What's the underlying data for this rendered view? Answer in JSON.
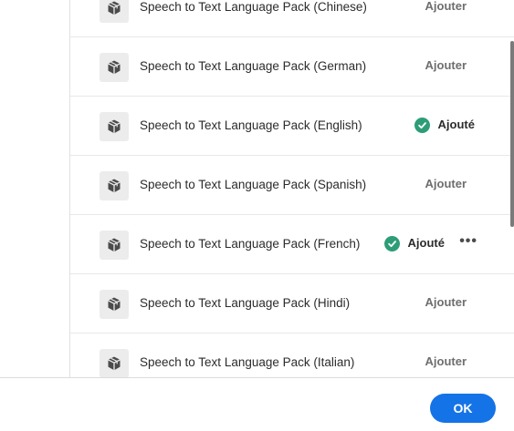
{
  "packages": [
    {
      "label": "Speech to Text Language Pack (Chinese)",
      "status": "add"
    },
    {
      "label": "Speech to Text Language Pack (German)",
      "status": "add"
    },
    {
      "label": "Speech to Text Language Pack (English)",
      "status": "added"
    },
    {
      "label": "Speech to Text Language Pack (Spanish)",
      "status": "add"
    },
    {
      "label": "Speech to Text Language Pack (French)",
      "status": "added_more"
    },
    {
      "label": "Speech to Text Language Pack (Hindi)",
      "status": "add"
    },
    {
      "label": "Speech to Text Language Pack (Italian)",
      "status": "add"
    }
  ],
  "labels": {
    "add": "Ajouter",
    "added": "Ajouté",
    "more": "•••"
  },
  "footer": {
    "ok_label": "OK"
  },
  "icons": {
    "package": "package-box-icon",
    "check": "checkmark-circle-icon",
    "more": "more-options-icon"
  },
  "colors": {
    "accent": "#1473e6",
    "success": "#2d9d78"
  }
}
